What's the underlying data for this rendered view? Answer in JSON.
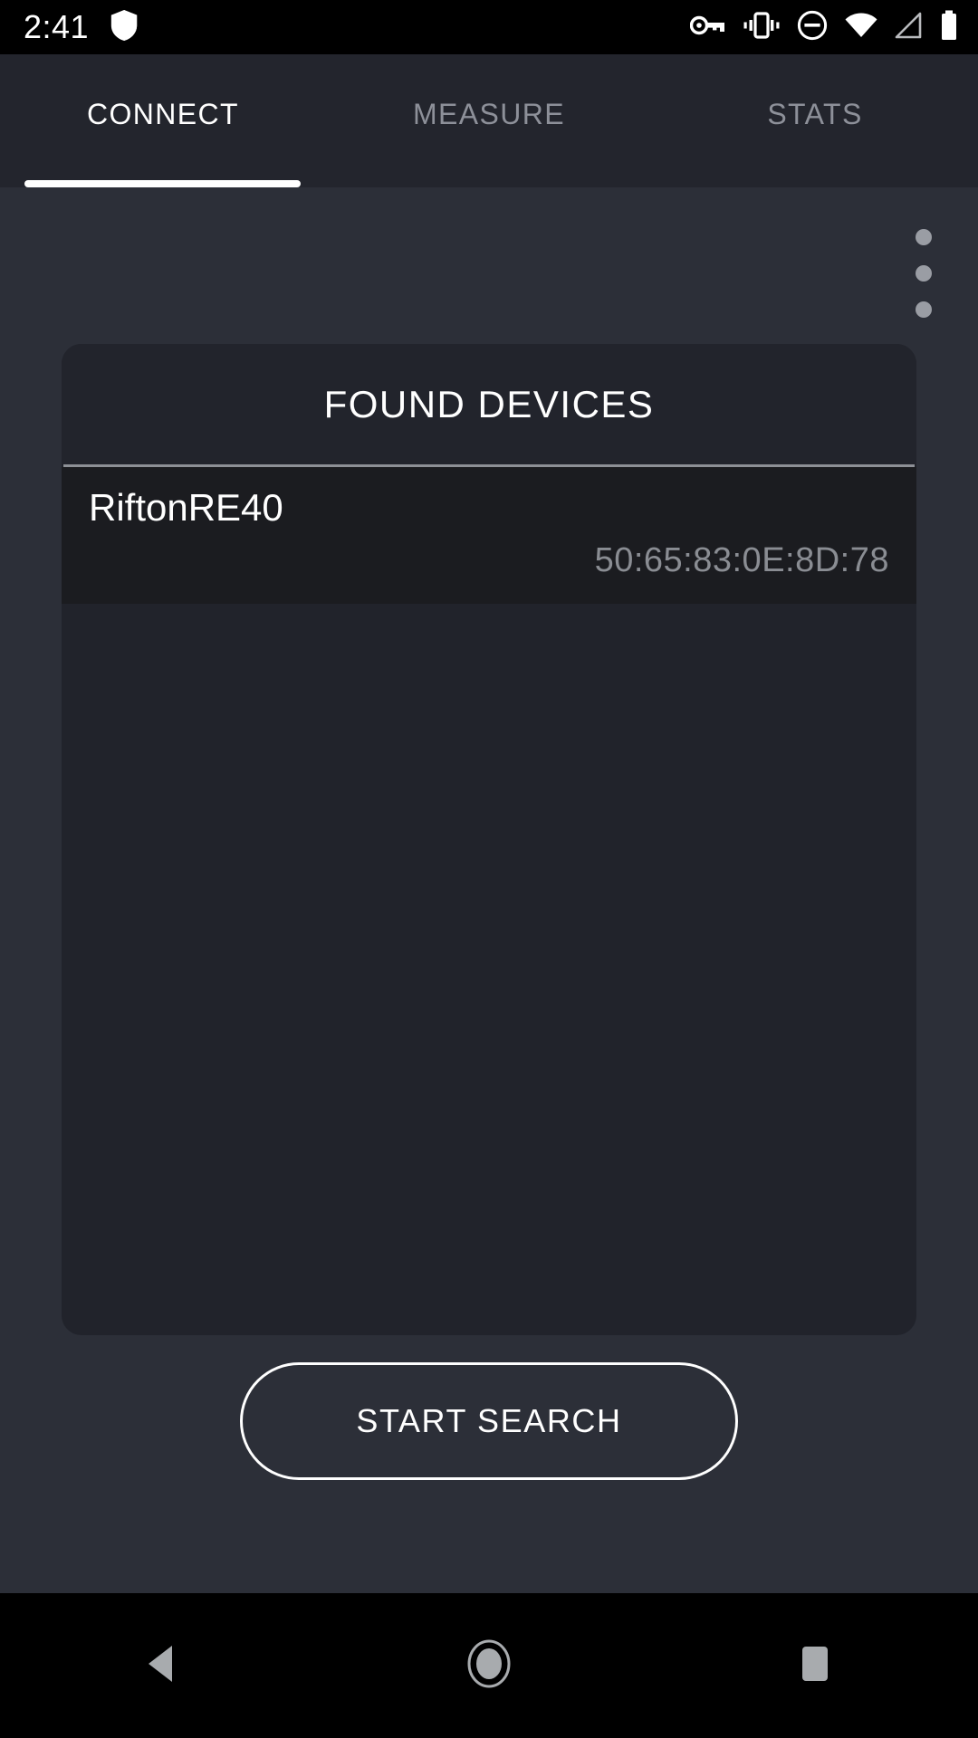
{
  "status_bar": {
    "time": "2:41",
    "left_icons": [
      {
        "name": "shield-icon"
      }
    ],
    "right_icons": [
      {
        "name": "vpn-key-icon"
      },
      {
        "name": "vibrate-icon"
      },
      {
        "name": "do-not-disturb-icon"
      },
      {
        "name": "wifi-icon"
      },
      {
        "name": "cell-signal-icon"
      },
      {
        "name": "battery-full-icon"
      }
    ]
  },
  "tabs": [
    {
      "label": "CONNECT",
      "active": true
    },
    {
      "label": "MEASURE",
      "active": false
    },
    {
      "label": "STATS",
      "active": false
    }
  ],
  "overflow_menu": {
    "name": "more-options",
    "dots": 3
  },
  "card": {
    "title": "FOUND DEVICES",
    "columns": [
      "name",
      "address"
    ],
    "devices": [
      {
        "name": "RiftonRE40",
        "address": "50:65:83:0E:8D:78"
      }
    ]
  },
  "actions": {
    "start_search_label": "START SEARCH"
  },
  "nav_bar": {
    "back_label": "Back",
    "home_label": "Home",
    "recents_label": "Recents"
  },
  "colors": {
    "page_background": "#2c2f38",
    "tab_bar_background": "#23252d",
    "card_background": "#21232b",
    "card_header_background": "#22242c",
    "device_row_background": "#1b1c20",
    "accent": "#ffffff",
    "muted_text": "#8a8d93",
    "tab_inactive_text": "#8d9099"
  }
}
